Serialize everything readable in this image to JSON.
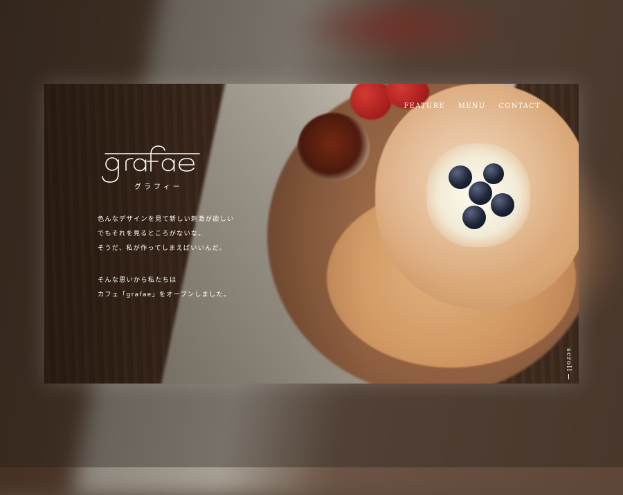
{
  "brand": {
    "logo_text": "grafae",
    "logo_sub": "グラフィー"
  },
  "nav": {
    "items": [
      {
        "label": "FEATURE"
      },
      {
        "label": "MENU"
      },
      {
        "label": "CONTACT"
      }
    ]
  },
  "intro": {
    "lines_1": [
      "色んなデザインを見て新しい刺激が欲しい",
      "でもそれを見るところがないな。",
      "そうだ、私が作ってしまえばいいんだ。"
    ],
    "lines_2": [
      "そんな思いから私たちは",
      "カフェ「grafae」をオープンしました。"
    ]
  },
  "scroll": {
    "label": "scroll"
  },
  "colors": {
    "text": "#ffffff",
    "wood": "#3e2a1e",
    "accent_berry": "#b3231f"
  }
}
